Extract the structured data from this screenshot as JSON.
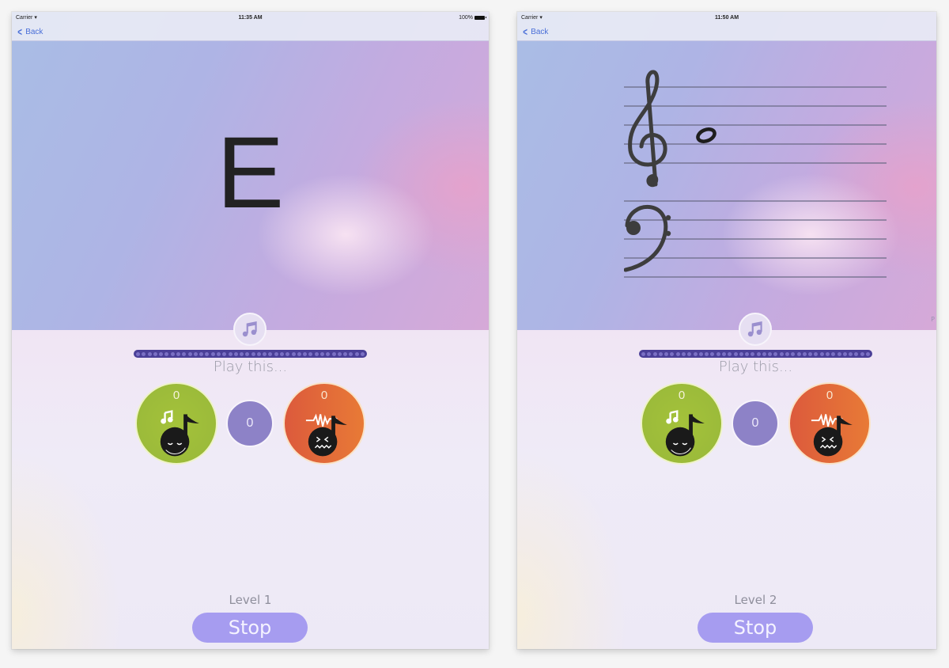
{
  "screens": [
    {
      "status": {
        "carrier": "Carrier",
        "time": "11:35 AM",
        "battery": "100%"
      },
      "nav": {
        "back_label": "Back"
      },
      "prompt_note": "E",
      "play_label": "Play this...",
      "progress_dots": 40,
      "scores": {
        "correct": "0",
        "neutral": "0",
        "wrong": "0"
      },
      "level_label": "Level 1",
      "stop_label": "Stop"
    },
    {
      "status": {
        "carrier": "Carrier",
        "time": "11:50 AM"
      },
      "nav": {
        "back_label": "Back"
      },
      "staff": {
        "clefs": [
          "treble",
          "bass"
        ],
        "note": "whole note on treble staff, between lines 2 and 3 (C5)"
      },
      "play_label": "Play this...",
      "progress_dots": 40,
      "scores": {
        "correct": "0",
        "neutral": "0",
        "wrong": "0"
      },
      "level_label": "Level 2",
      "stop_label": "Stop",
      "edge_text": "P"
    }
  ],
  "icons": {
    "play_button": "music-note-icon",
    "correct_badge": "happy-note-icon",
    "wrong_badge": "distressed-note-icon",
    "back": "chevron-left-icon",
    "wifi": "wifi-icon",
    "battery": "battery-icon"
  },
  "colors": {
    "accent": "#a69cf0",
    "progress": "#4a3f97",
    "correct": "#9cbb3a",
    "neutral": "#8d82c7",
    "wrong": "#e06a3a",
    "link": "#4a6fd8"
  }
}
